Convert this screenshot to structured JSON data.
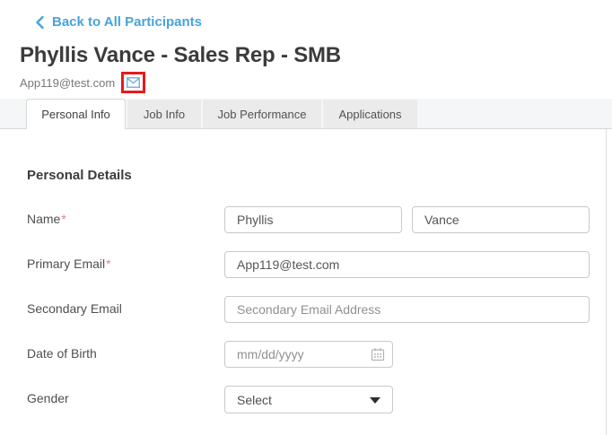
{
  "header": {
    "back_link_label": "Back to All Participants",
    "title": "Phyllis Vance - Sales Rep - SMB",
    "email": "App119@test.com"
  },
  "tabs": [
    {
      "label": "Personal Info",
      "active": true
    },
    {
      "label": "Job Info",
      "active": false
    },
    {
      "label": "Job Performance",
      "active": false
    },
    {
      "label": "Applications",
      "active": false
    }
  ],
  "section_title": "Personal Details",
  "form": {
    "required_marker": "*",
    "name": {
      "label": "Name",
      "first_name_value": "Phyllis",
      "last_name_value": "Vance"
    },
    "primary_email": {
      "label": "Primary Email",
      "value": "App119@test.com"
    },
    "secondary_email": {
      "label": "Secondary Email",
      "placeholder": "Secondary Email Address"
    },
    "date_of_birth": {
      "label": "Date of Birth",
      "placeholder": "mm/dd/yyyy"
    },
    "gender": {
      "label": "Gender",
      "selected_value": "Select"
    }
  },
  "colors": {
    "link_blue": "#48a3d9",
    "highlight_red": "#e8191c",
    "envelope_blue": "#79b6da",
    "required_pink": "#e57e8c",
    "tab_strip_bg": "#f5f6f7",
    "tab_inactive_bg": "#ebebec"
  }
}
